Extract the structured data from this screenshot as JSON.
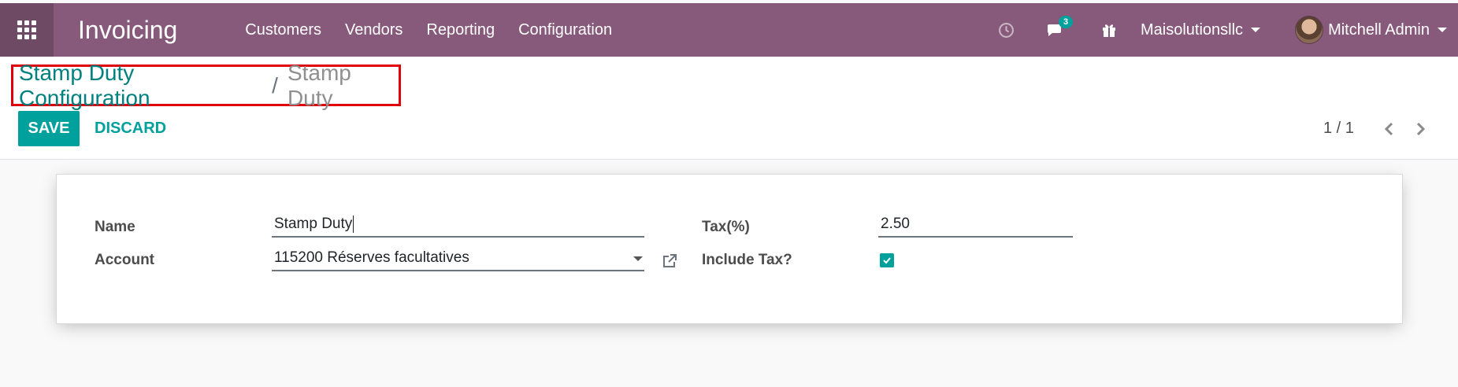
{
  "navbar": {
    "app_title": "Invoicing",
    "menu": [
      "Customers",
      "Vendors",
      "Reporting",
      "Configuration"
    ],
    "messages_count": "3",
    "company": "Maisolutionsllc",
    "user": "Mitchell Admin"
  },
  "breadcrumb": {
    "parent": "Stamp Duty Configuration",
    "separator": "/",
    "current": "Stamp Duty"
  },
  "buttons": {
    "save": "SAVE",
    "discard": "DISCARD"
  },
  "pager": {
    "text": "1 / 1"
  },
  "form": {
    "name_label": "Name",
    "name_value": "Stamp Duty",
    "account_label": "Account",
    "account_value": "115200 Réserves facultatives",
    "tax_label": "Tax(%)",
    "tax_value": "2.50",
    "include_tax_label": "Include Tax?",
    "include_tax_checked": true
  },
  "colors": {
    "navbar": "#875a7b",
    "accent": "#00a09d",
    "highlight_box": "#e0000c"
  },
  "icons": [
    "apps-grid-icon",
    "clock-icon",
    "chat-icon",
    "gift-icon",
    "external-link-icon",
    "check-icon",
    "chevron-left-icon",
    "chevron-right-icon"
  ]
}
